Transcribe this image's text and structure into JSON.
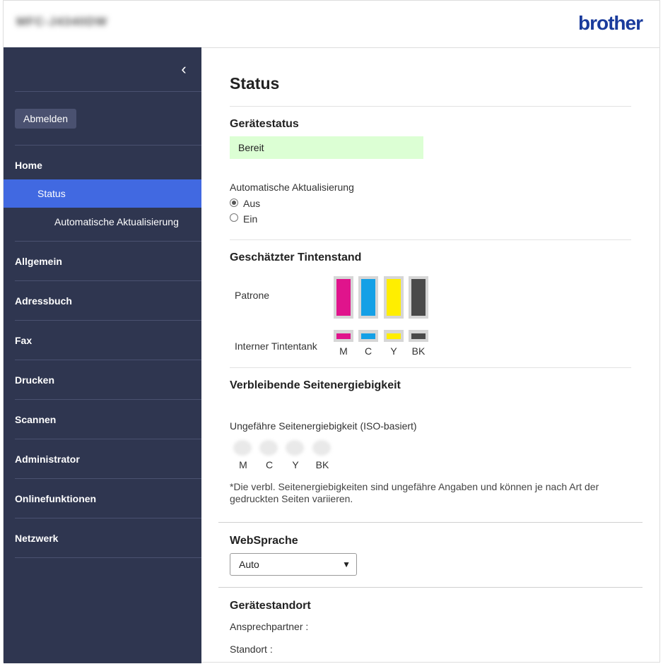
{
  "header": {
    "model_name": "MFC-J4340DW",
    "brand": "brother"
  },
  "sidebar": {
    "logout_label": "Abmelden",
    "items": [
      {
        "label": "Home"
      },
      {
        "label": "Status"
      },
      {
        "label": "Automatische Aktualisierung"
      },
      {
        "label": "Allgemein"
      },
      {
        "label": "Adressbuch"
      },
      {
        "label": "Fax"
      },
      {
        "label": "Drucken"
      },
      {
        "label": "Scannen"
      },
      {
        "label": "Administrator"
      },
      {
        "label": "Onlinefunktionen"
      },
      {
        "label": "Netzwerk"
      }
    ]
  },
  "main": {
    "title": "Status",
    "device_status": {
      "heading": "Gerätestatus",
      "value": "Bereit",
      "color": "#dcffd4"
    },
    "auto_update": {
      "label": "Automatische Aktualisierung",
      "options": [
        "Aus",
        "Ein"
      ],
      "selected": "Aus"
    },
    "ink": {
      "heading": "Geschätzter Tintenstand",
      "cartridge_label": "Patrone",
      "tank_label": "Interner Tintentank",
      "colors": [
        {
          "name": "M",
          "hex": "#e0148c"
        },
        {
          "name": "C",
          "hex": "#14a0e6"
        },
        {
          "name": "Y",
          "hex": "#ffee00"
        },
        {
          "name": "BK",
          "hex": "#4a4a4a"
        }
      ]
    },
    "yield": {
      "heading": "Verbleibende Seitenergiebigkeit",
      "sublabel": "Ungefähre Seitenergiebigkeit (ISO-basiert)",
      "labels": [
        "M",
        "C",
        "Y",
        "BK"
      ],
      "note": "*Die verbl. Seitenergiebigkeiten sind ungefähre Angaben und können je nach Art der gedruckten Seiten variieren."
    },
    "language": {
      "heading": "WebSprache",
      "selected": "Auto"
    },
    "location": {
      "heading": "Gerätestandort",
      "contact_label": "Ansprechpartner :",
      "location_label": "Standort :"
    }
  }
}
